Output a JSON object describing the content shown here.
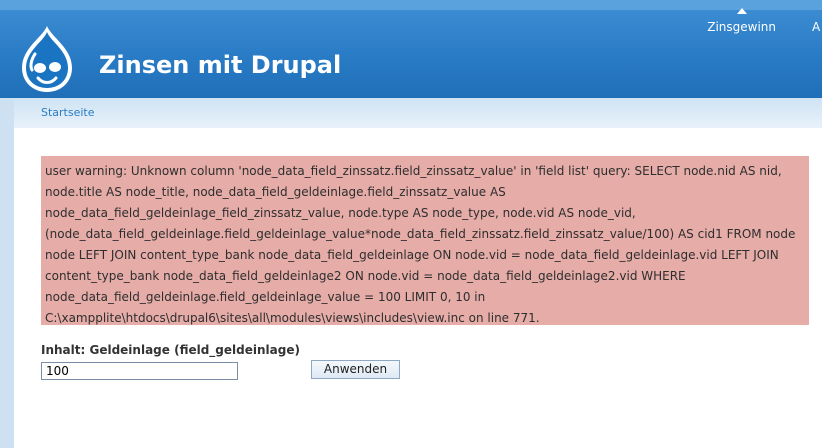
{
  "header": {
    "site_name": "Zinsen mit Drupal",
    "primary_links": [
      {
        "label": "Zinsgewinn",
        "active": true
      },
      {
        "label": "A",
        "active": false
      }
    ]
  },
  "breadcrumb": {
    "items": [
      "Startseite"
    ]
  },
  "messages": {
    "error": "user warning: Unknown column 'node_data_field_zinssatz.field_zinssatz_value' in 'field list' query: SELECT node.nid AS nid, node.title AS node_title, node_data_field_geldeinlage.field_zinssatz_value AS node_data_field_geldeinlage_field_zinssatz_value, node.type AS node_type, node.vid AS node_vid, (node_data_field_geldeinlage.field_geldeinlage_value*node_data_field_zinssatz.field_zinssatz_value/100) AS cid1 FROM node node LEFT JOIN content_type_bank node_data_field_geldeinlage ON node.vid = node_data_field_geldeinlage.vid LEFT JOIN content_type_bank node_data_field_geldeinlage2 ON node.vid = node_data_field_geldeinlage2.vid WHERE node_data_field_geldeinlage.field_geldeinlage_value = 100 LIMIT 0, 10 in C:\\xampplite\\htdocs\\drupal6\\sites\\all\\modules\\views\\includes\\view.inc on line 771."
  },
  "filter": {
    "label": "Inhalt: Geldeinlage (field_geldeinlage)",
    "value": "100",
    "apply_label": "Anwenden"
  },
  "colors": {
    "header_blue": "#2a7cc6",
    "error_bg": "#e5aca8",
    "link": "#2a7cc6"
  }
}
